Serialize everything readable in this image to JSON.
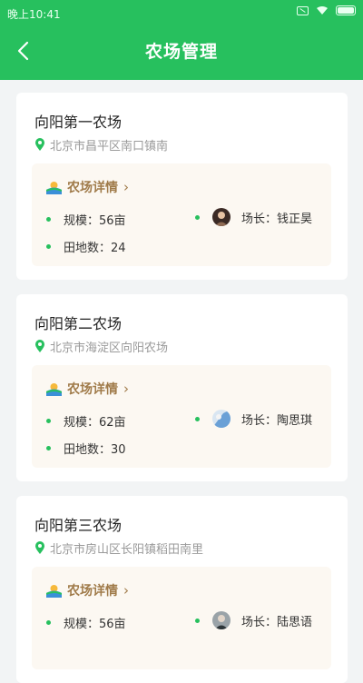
{
  "status": {
    "time": "晚上10:41"
  },
  "header": {
    "title": "农场管理"
  },
  "colors": {
    "brand_green": "#27c05e",
    "detail_bg": "#fcf8f2",
    "detail_text": "#a07b4a"
  },
  "farms": [
    {
      "name": "向阳第一农场",
      "address": "北京市昌平区南口镇南",
      "detail_label": "农场详情",
      "scale": "规模：56亩",
      "manager": "场长：钱正昊",
      "fields": "田地数：24"
    },
    {
      "name": "向阳第二农场",
      "address": "北京市海淀区向阳农场",
      "detail_label": "农场详情",
      "scale": "规模：62亩",
      "manager": "场长：陶思琪",
      "fields": "田地数：30"
    },
    {
      "name": "向阳第三农场",
      "address": "北京市房山区长阳镇稻田南里",
      "detail_label": "农场详情",
      "scale": "规模：56亩",
      "manager": "场长：陆思语",
      "fields": ""
    }
  ]
}
